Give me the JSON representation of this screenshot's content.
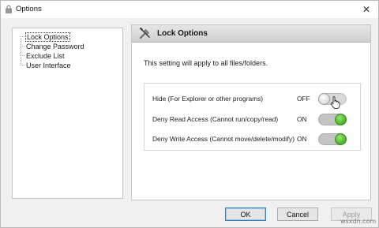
{
  "window": {
    "title": "Options",
    "close_glyph": "✕",
    "app_icon": "padlock-icon"
  },
  "tree": {
    "items": [
      {
        "label": "Lock Options",
        "selected": true
      },
      {
        "label": "Change Password",
        "selected": false
      },
      {
        "label": "Exclude List",
        "selected": false
      },
      {
        "label": "User Interface",
        "selected": false
      }
    ]
  },
  "panel": {
    "title": "Lock Options",
    "header_icon": "tools-icon",
    "description": "This setting will apply to all files/folders.",
    "options": [
      {
        "label": "Hide (For Explorer or other programs)",
        "state": "OFF",
        "on": false
      },
      {
        "label": "Deny Read Access (Cannot run/copy/read)",
        "state": "ON",
        "on": true
      },
      {
        "label": "Deny Write Access (Cannot move/delete/modify)",
        "state": "ON",
        "on": true
      }
    ]
  },
  "buttons": {
    "ok": "OK",
    "cancel": "Cancel",
    "apply": "Apply"
  },
  "watermark": "wsxdn.com",
  "colors": {
    "toggle_on": "#4fba2a",
    "ok_border": "#3c7fb1"
  }
}
